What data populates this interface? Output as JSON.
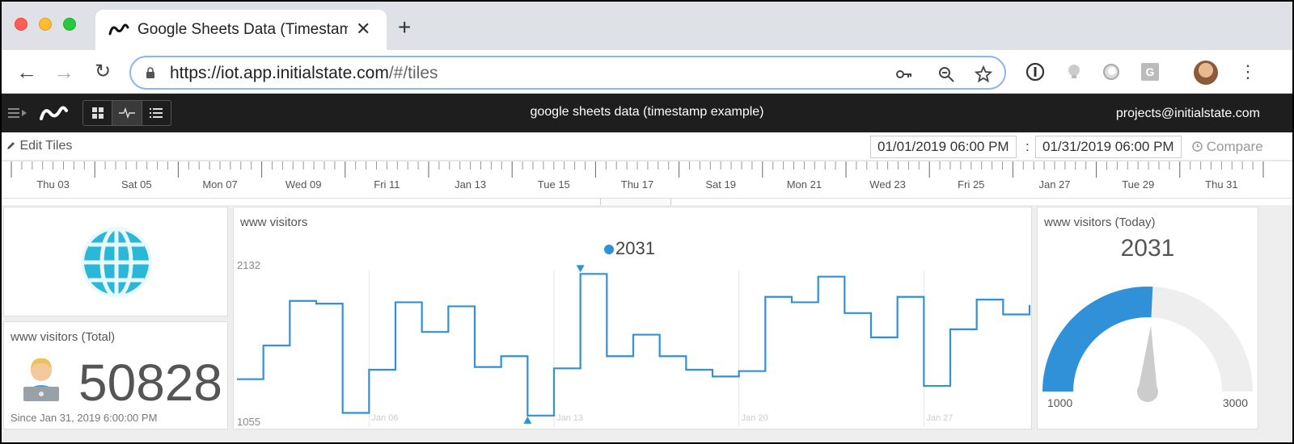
{
  "browser": {
    "tab_title": "Google Sheets Data (Timestamp Example)",
    "url_host": "https://iot.app.initialstate.com",
    "url_path": "/#/tiles"
  },
  "app": {
    "title": "google sheets data (timestamp example)",
    "user_email": "projects@initialstate.com"
  },
  "editbar": {
    "edit_label": "Edit Tiles",
    "start_date": "01/01/2019 06:00 PM",
    "separator": ":",
    "end_date": "01/31/2019 06:00 PM",
    "compare_label": "Compare"
  },
  "timeline": {
    "day_labels": [
      "Thu 03",
      "Sat 05",
      "Mon 07",
      "Wed 09",
      "Fri 11",
      "Jan 13",
      "Tue 15",
      "Thu 17",
      "Sat 19",
      "Mon 21",
      "Wed 23",
      "Fri 25",
      "Jan 27",
      "Tue 29",
      "Thu 31"
    ]
  },
  "tiles": {
    "total": {
      "title": "www visitors (Total)",
      "value": "50828",
      "since": "Since Jan 31, 2019 6:00:00 PM"
    },
    "line": {
      "title": "www visitors",
      "legend_value": "2031"
    },
    "today": {
      "title": "www visitors (Today)",
      "value": "2031",
      "gauge_value": 2031,
      "gauge_min": "1000",
      "gauge_max": "3000"
    }
  },
  "colors": {
    "accent": "#3090d8",
    "header_bg": "#1e1e1e"
  },
  "chart_data": {
    "type": "line",
    "title": "www visitors",
    "ymin_label": "1055",
    "ymax_label": "2132",
    "ylim": [
      1055,
      2132
    ],
    "x_labels": [
      "Jan 06",
      "Jan 13",
      "Jan 20",
      "Jan 27"
    ],
    "x": [
      "Jan 01",
      "Jan 02",
      "Jan 03",
      "Jan 04",
      "Jan 05",
      "Jan 06",
      "Jan 07",
      "Jan 08",
      "Jan 09",
      "Jan 10",
      "Jan 11",
      "Jan 12",
      "Jan 13",
      "Jan 14",
      "Jan 15",
      "Jan 16",
      "Jan 17",
      "Jan 18",
      "Jan 19",
      "Jan 20",
      "Jan 21",
      "Jan 22",
      "Jan 23",
      "Jan 24",
      "Jan 25",
      "Jan 26",
      "Jan 27",
      "Jan 28",
      "Jan 29",
      "Jan 30",
      "Jan 31"
    ],
    "values": [
      1350,
      1600,
      1930,
      1910,
      1100,
      1420,
      1920,
      1700,
      1890,
      1440,
      1520,
      1080,
      1430,
      2130,
      1520,
      1680,
      1520,
      1420,
      1370,
      1410,
      1960,
      1920,
      2110,
      1840,
      1660,
      1960,
      1300,
      1720,
      1940,
      1830,
      1900
    ],
    "markers": {
      "max_index": 13,
      "min_index": 11
    }
  }
}
